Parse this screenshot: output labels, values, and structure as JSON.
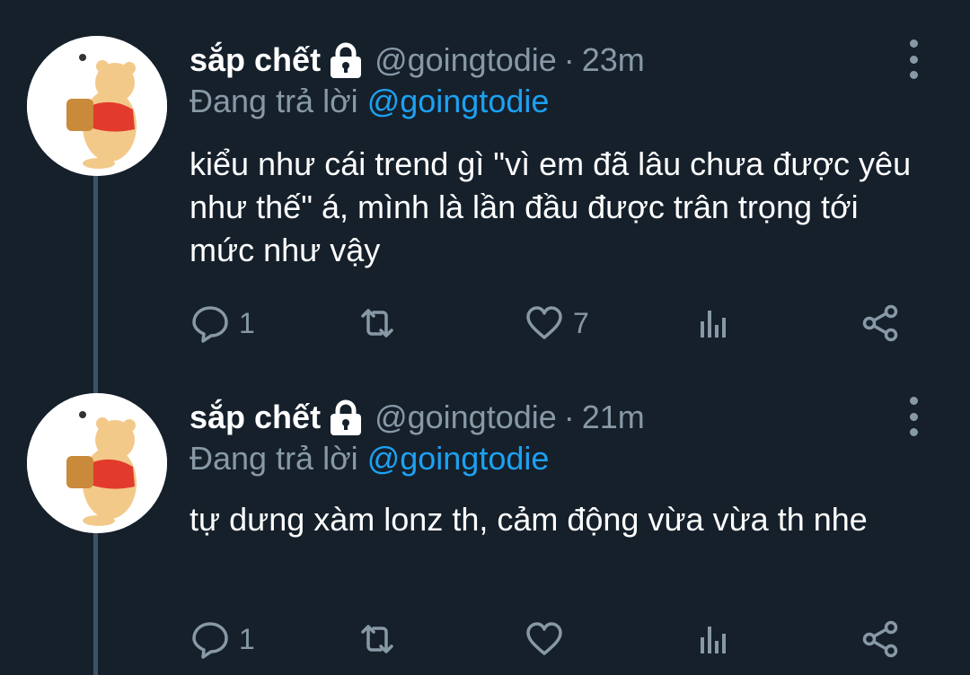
{
  "tweets": [
    {
      "name": "sắp chết",
      "handle": "@goingtodie",
      "separator": "·",
      "time": "23m",
      "replying_prefix": "Đang trả lời",
      "replying_to": "@goingtodie",
      "text": "kiểu như cái trend gì \"vì em đã lâu chưa được yêu như thế\" á, mình là lần đầu được trân trọng tới mức như vậy",
      "reply_count": "1",
      "retweet_count": "",
      "like_count": "7"
    },
    {
      "name": "sắp chết",
      "handle": "@goingtodie",
      "separator": "·",
      "time": "21m",
      "replying_prefix": "Đang trả lời",
      "replying_to": "@goingtodie",
      "text": "tự dưng xàm lonz th, cảm động vừa vừa th nhe",
      "reply_count": "1",
      "retweet_count": "",
      "like_count": ""
    }
  ],
  "icons": {
    "lock": "lock-icon",
    "more": "more-vertical-icon",
    "reply": "reply-icon",
    "retweet": "retweet-icon",
    "like": "heart-icon",
    "analytics": "analytics-icon",
    "share": "share-icon"
  },
  "colors": {
    "background": "#15202b",
    "secondary_text": "#8899a6",
    "mention": "#1da1f2",
    "thread_line": "#3d5466"
  }
}
